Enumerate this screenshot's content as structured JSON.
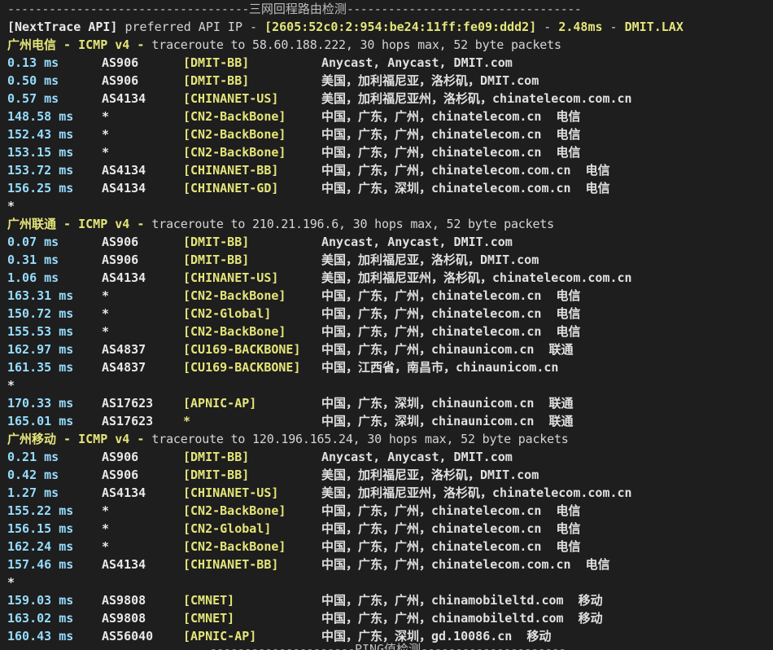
{
  "top_separator": {
    "dashes_left": "-----------------------------------",
    "title": "三网回程路由检测",
    "dashes_right": "----------------------------------"
  },
  "api_line": {
    "label": "[NextTrace API]",
    "text1": " preferred API IP - ",
    "ip": "[2605:52c0:2:954:be24:11ff:fe09:ddd2]",
    "sep1": " - ",
    "latency": "2.48ms",
    "sep2": " - ",
    "node": "DMIT.LAX"
  },
  "sections": [
    {
      "name": "广州电信",
      "protocol": " - ICMP v4 - ",
      "trace": "traceroute to 58.60.188.222, 30 hops max, 52 byte packets",
      "hops": [
        {
          "ms": "0.13 ms",
          "asn": "AS906",
          "tag": "[DMIT-BB]",
          "geo": "Anycast, Anycast, DMIT.com"
        },
        {
          "ms": "0.50 ms",
          "asn": "AS906",
          "tag": "[DMIT-BB]",
          "geo": "美国，加利福尼亚，洛杉矶，DMIT.com"
        },
        {
          "ms": "0.57 ms",
          "asn": "AS4134",
          "tag": "[CHINANET-US]",
          "geo": "美国，加利福尼亚州，洛杉矶，chinatelecom.com.cn"
        },
        {
          "ms": "148.58 ms",
          "asn": "*",
          "tag": "[CN2-BackBone]",
          "geo": "中国，广东，广州，chinatelecom.cn  电信"
        },
        {
          "ms": "152.43 ms",
          "asn": "*",
          "tag": "[CN2-BackBone]",
          "geo": "中国，广东，广州，chinatelecom.cn  电信"
        },
        {
          "ms": "153.15 ms",
          "asn": "*",
          "tag": "[CN2-BackBone]",
          "geo": "中国，广东，广州，chinatelecom.cn  电信"
        },
        {
          "ms": "153.72 ms",
          "asn": "AS4134",
          "tag": "[CHINANET-BB]",
          "geo": "中国，广东，广州，chinatelecom.com.cn  电信"
        },
        {
          "ms": "156.25 ms",
          "asn": "AS4134",
          "tag": "[CHINANET-GD]",
          "geo": "中国，广东，深圳，chinatelecom.com.cn  电信"
        },
        {
          "star": "*"
        }
      ]
    },
    {
      "name": "广州联通",
      "protocol": " - ICMP v4 - ",
      "trace": "traceroute to 210.21.196.6, 30 hops max, 52 byte packets",
      "hops": [
        {
          "ms": "0.07 ms",
          "asn": "AS906",
          "tag": "[DMIT-BB]",
          "geo": "Anycast, Anycast, DMIT.com"
        },
        {
          "ms": "0.31 ms",
          "asn": "AS906",
          "tag": "[DMIT-BB]",
          "geo": "美国，加利福尼亚，洛杉矶，DMIT.com"
        },
        {
          "ms": "1.06 ms",
          "asn": "AS4134",
          "tag": "[CHINANET-US]",
          "geo": "美国，加利福尼亚州，洛杉矶，chinatelecom.com.cn"
        },
        {
          "ms": "163.31 ms",
          "asn": "*",
          "tag": "[CN2-BackBone]",
          "geo": "中国，广东，广州，chinatelecom.cn  电信"
        },
        {
          "ms": "150.72 ms",
          "asn": "*",
          "tag": "[CN2-Global]",
          "geo": "中国，广东，广州，chinatelecom.cn  电信"
        },
        {
          "ms": "155.53 ms",
          "asn": "*",
          "tag": "[CN2-BackBone]",
          "geo": "中国，广东，广州，chinatelecom.cn  电信"
        },
        {
          "ms": "162.97 ms",
          "asn": "AS4837",
          "tag": "[CU169-BACKBONE]",
          "geo": "中国，广东，广州，chinaunicom.cn  联通"
        },
        {
          "ms": "161.35 ms",
          "asn": "AS4837",
          "tag": "[CU169-BACKBONE]",
          "geo": "中国，江西省，南昌市，chinaunicom.cn"
        },
        {
          "star": "*"
        },
        {
          "ms": "170.33 ms",
          "asn": "AS17623",
          "tag": "[APNIC-AP]",
          "geo": "中国，广东，深圳，chinaunicom.cn  联通"
        },
        {
          "ms": "165.01 ms",
          "asn": "AS17623",
          "tag": "*",
          "geo": "中国，广东，深圳，chinaunicom.cn  联通"
        }
      ]
    },
    {
      "name": "广州移动",
      "protocol": " - ICMP v4 - ",
      "trace": "traceroute to 120.196.165.24, 30 hops max, 52 byte packets",
      "hops": [
        {
          "ms": "0.21 ms",
          "asn": "AS906",
          "tag": "[DMIT-BB]",
          "geo": "Anycast, Anycast, DMIT.com"
        },
        {
          "ms": "0.42 ms",
          "asn": "AS906",
          "tag": "[DMIT-BB]",
          "geo": "美国，加利福尼亚，洛杉矶，DMIT.com"
        },
        {
          "ms": "1.27 ms",
          "asn": "AS4134",
          "tag": "[CHINANET-US]",
          "geo": "美国，加利福尼亚州，洛杉矶，chinatelecom.com.cn"
        },
        {
          "ms": "155.22 ms",
          "asn": "*",
          "tag": "[CN2-BackBone]",
          "geo": "中国，广东，广州，chinatelecom.cn  电信"
        },
        {
          "ms": "156.15 ms",
          "asn": "*",
          "tag": "[CN2-Global]",
          "geo": "中国，广东，广州，chinatelecom.cn  电信"
        },
        {
          "ms": "162.24 ms",
          "asn": "*",
          "tag": "[CN2-BackBone]",
          "geo": "中国，广东，广州，chinatelecom.cn  电信"
        },
        {
          "ms": "157.46 ms",
          "asn": "AS4134",
          "tag": "[CHINANET-BB]",
          "geo": "中国，广东，广州，chinatelecom.com.cn  电信"
        },
        {
          "star": "*"
        },
        {
          "ms": "159.03 ms",
          "asn": "AS9808",
          "tag": "[CMNET]",
          "geo": "中国，广东，广州，chinamobileltd.com  移动"
        },
        {
          "ms": "163.02 ms",
          "asn": "AS9808",
          "tag": "[CMNET]",
          "geo": "中国，广东，广州，chinamobileltd.com  移动"
        },
        {
          "ms": "160.43 ms",
          "asn": "AS56040",
          "tag": "[APNIC-AP]",
          "geo": "中国，广东，深圳，gd.10086.cn  移动"
        }
      ]
    }
  ],
  "bottom_separator": {
    "dashes_left": "---------------------",
    "title": "PING值检测",
    "dashes_right": "---------------------"
  },
  "colors": {
    "background": "#1e1e1e",
    "cyan": "#96dcfe",
    "yellow": "#e5e57a",
    "white": "#e8e8e8",
    "gray": "#d4d4d4"
  }
}
